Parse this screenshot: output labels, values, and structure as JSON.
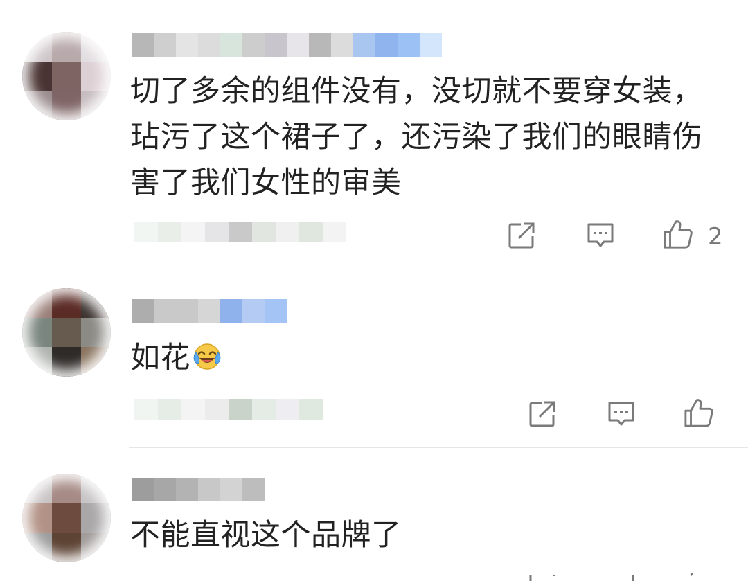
{
  "comments": [
    {
      "text": "切了多余的组件没有，没切就不要穿女装，玷污了这个裙子了，还污染了我们的眼睛伤害了我们女性的审美",
      "like_count": "2",
      "username_mosaic_colors": [
        "#b7b7b7",
        "#cfcfcf",
        "#e4e4e4",
        "#dcdcdc",
        "#d8e5dc",
        "#cdcdcd",
        "#c8c6cc",
        "#e7e4ea",
        "#b8b8b8",
        "#dcdcdc",
        "#a8c6f0",
        "#8fb4ee",
        "#9cc1f4",
        "#d4e6fb"
      ],
      "meta_mosaic_colors": [
        "#f2f6f3",
        "#e9eee9",
        "#f4f4f4",
        "#e5e5e8",
        "#c9c9c9",
        "#e1e6e1",
        "#f0f0f0",
        "#dfe7df",
        "#f3f3f3"
      ],
      "avatar_colors": [
        "#cfc6c9",
        "#b8a9ab",
        "#e2dde0",
        "#4a3433",
        "#7e6463",
        "#ddd0d4",
        "#9b8d8f",
        "#7f6566",
        "#c7bcbf"
      ]
    },
    {
      "text": "如花",
      "emoji": "crying-laughing-emoji",
      "like_count": "",
      "username_mosaic_colors": [
        "#adadad",
        "#c9c9c9",
        "#c9c9c9",
        "#d6d6d6",
        "#8fb2ec",
        "#b4ccf3",
        "#a4c4f6"
      ],
      "meta_mosaic_colors": [
        "#f1f5f1",
        "#e6ece6",
        "#f4f4f4",
        "#ececec",
        "#c9d3c9",
        "#e5ece5",
        "#eeeef2",
        "#dfe9df"
      ],
      "avatar_colors": [
        "#9b7f79",
        "#5b2b25",
        "#3d3430",
        "#7a857e",
        "#675a4f",
        "#8b8a84",
        "#b0b4ae",
        "#2f2b28",
        "#8a745f"
      ]
    },
    {
      "text": "不能直视这个品牌了",
      "like_count": "",
      "username_mosaic_colors": [
        "#9d9d9d",
        "#a7a7a7",
        "#b3b3b3",
        "#c8c8c8",
        "#d3d3d3",
        "#bdbdbd"
      ],
      "meta_mosaic_colors": [],
      "avatar_colors": [
        "#c9c3c4",
        "#a68a85",
        "#c7c4c6",
        "#b29286",
        "#6e4b3f",
        "#a9a7a8",
        "#9d9d9d",
        "#5d4334",
        "#a09b99"
      ]
    }
  ],
  "icons": {
    "share": "share-icon",
    "reply": "comment-icon",
    "like": "thumbs-up-icon"
  },
  "colors": {
    "text": "#222222",
    "icon": "#7a7a7a",
    "divider": "#e6e6e6",
    "username_blue": "#8fb4ee"
  }
}
